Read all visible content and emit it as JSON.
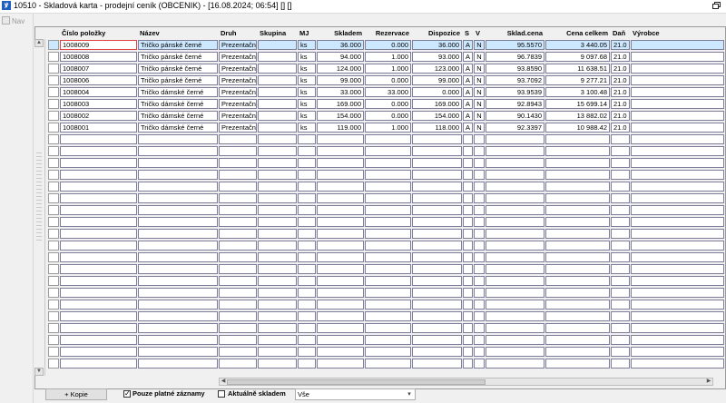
{
  "window": {
    "title": "10510 - Skladová karta - prodejní ceník (OBCENIK) - [16.08.2024; 06:54]  [] []"
  },
  "sidebar": {
    "nav_label": "Nav"
  },
  "grid": {
    "columns": [
      "Číslo položky",
      "Název",
      "Druh",
      "Skupina",
      "MJ",
      "Skladem",
      "Rezervace",
      "Dispozice",
      "S",
      "V",
      "Sklad.cena",
      "Cena celkem",
      "Daň",
      "Výrobce"
    ],
    "rows": [
      [
        "1008009",
        "Tričko pánské černé",
        "Prezentačn",
        "",
        "ks",
        "36.000",
        "0.000",
        "36.000",
        "A",
        "N",
        "95.5570",
        "3 440.05",
        "21.0",
        ""
      ],
      [
        "1008008",
        "Tričko pánské černé",
        "Prezentačn",
        "",
        "ks",
        "94.000",
        "1.000",
        "93.000",
        "A",
        "N",
        "96.7839",
        "9 097.68",
        "21.0",
        ""
      ],
      [
        "1008007",
        "Tričko pánské černé",
        "Prezentačn",
        "",
        "ks",
        "124.000",
        "1.000",
        "123.000",
        "A",
        "N",
        "93.8590",
        "11 638.51",
        "21.0",
        ""
      ],
      [
        "1008006",
        "Tričko pánské černé",
        "Prezentačn",
        "",
        "ks",
        "99.000",
        "0.000",
        "99.000",
        "A",
        "N",
        "93.7092",
        "9 277.21",
        "21.0",
        ""
      ],
      [
        "1008004",
        "Tričko dámské černé",
        "Prezentačn",
        "",
        "ks",
        "33.000",
        "33.000",
        "0.000",
        "A",
        "N",
        "93.9539",
        "3 100.48",
        "21.0",
        ""
      ],
      [
        "1008003",
        "Tričko dámské černé",
        "Prezentačn",
        "",
        "ks",
        "169.000",
        "0.000",
        "169.000",
        "A",
        "N",
        "92.8943",
        "15 699.14",
        "21.0",
        ""
      ],
      [
        "1008002",
        "Tričko dámské černé",
        "Prezentačn",
        "",
        "ks",
        "154.000",
        "0.000",
        "154.000",
        "A",
        "N",
        "90.1430",
        "13 882.02",
        "21.0",
        ""
      ],
      [
        "1008001",
        "Tričko dámské černé",
        "Prezentačn",
        "",
        "ks",
        "119.000",
        "1.000",
        "118.000",
        "A",
        "N",
        "92.3397",
        "10 988.42",
        "21.0",
        ""
      ]
    ]
  },
  "footer": {
    "copy_button": "+ Kopie",
    "valid_only": {
      "label": "Pouze platné záznamy",
      "checked": true
    },
    "in_stock": {
      "label": "Aktuálně skladem",
      "checked": false
    },
    "filter": {
      "value": "Vše"
    }
  },
  "colors": {
    "selected_row": "#cce8ff",
    "cell_border": "#7d7d9a",
    "focus_border": "#e04040"
  }
}
